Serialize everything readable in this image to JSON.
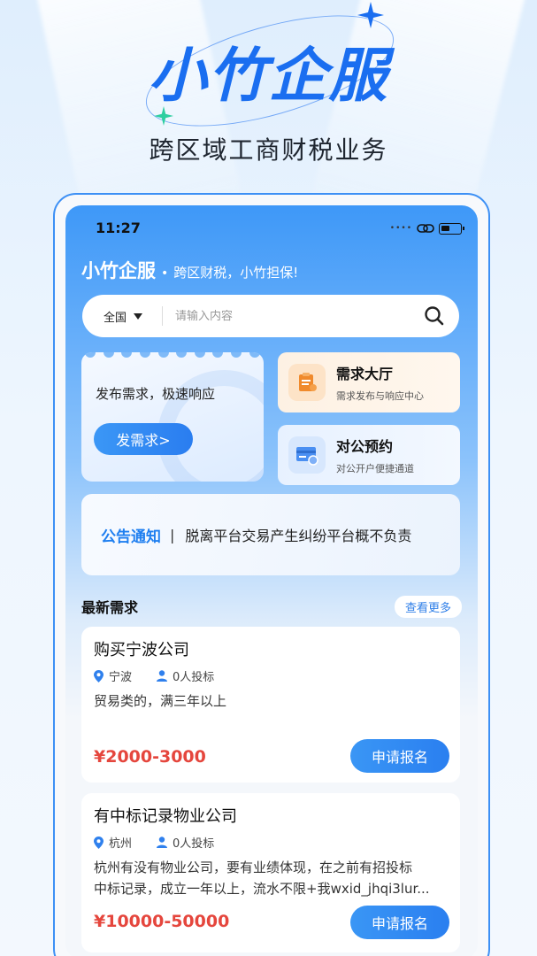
{
  "promo": {
    "brand": "小竹企服",
    "tagline": "跨区域工商财税业务"
  },
  "status_bar": {
    "time": "11:27"
  },
  "header": {
    "app_name": "小竹企服",
    "separator": "•",
    "slogan": "跨区财税，小竹担保!"
  },
  "search": {
    "region": "全国",
    "placeholder": "请输入内容"
  },
  "post_card": {
    "text": "发布需求，极速响应",
    "button": "发需求>"
  },
  "demand_hall": {
    "title": "需求大厅",
    "subtitle": "需求发布与响应中心"
  },
  "appointment": {
    "title": "对公预约",
    "subtitle": "对公开户便捷通道"
  },
  "notice": {
    "tag": "公告通知",
    "separator": "|",
    "text": "脱离平台交易产生纠纷平台概不负责"
  },
  "latest": {
    "title": "最新需求",
    "more": "查看更多",
    "items": [
      {
        "title": "购买宁波公司",
        "city": "宁波",
        "bids": "0人投标",
        "desc_lines": [
          "贸易类的，满三年以上"
        ],
        "price": "¥2000-3000",
        "apply": "申请报名"
      },
      {
        "title": "有中标记录物业公司",
        "city": "杭州",
        "bids": "0人投标",
        "desc_lines": [
          "杭州有没有物业公司，要有业绩体现，在之前有招投标",
          "中标记录，成立一年以上，流水不限+我wxid_jhqi3lur..."
        ],
        "price": "¥10000-50000",
        "apply": "申请报名"
      }
    ]
  },
  "colors": {
    "brand_blue": "#1a6ef0",
    "price_red": "#e5463d",
    "button_blue": "#2a7ff0"
  },
  "icons": [
    "sparkle-icon",
    "link-icon",
    "battery-icon",
    "caret-down-icon",
    "search-icon",
    "demand-hall-icon",
    "id-card-icon",
    "location-icon",
    "person-icon"
  ]
}
